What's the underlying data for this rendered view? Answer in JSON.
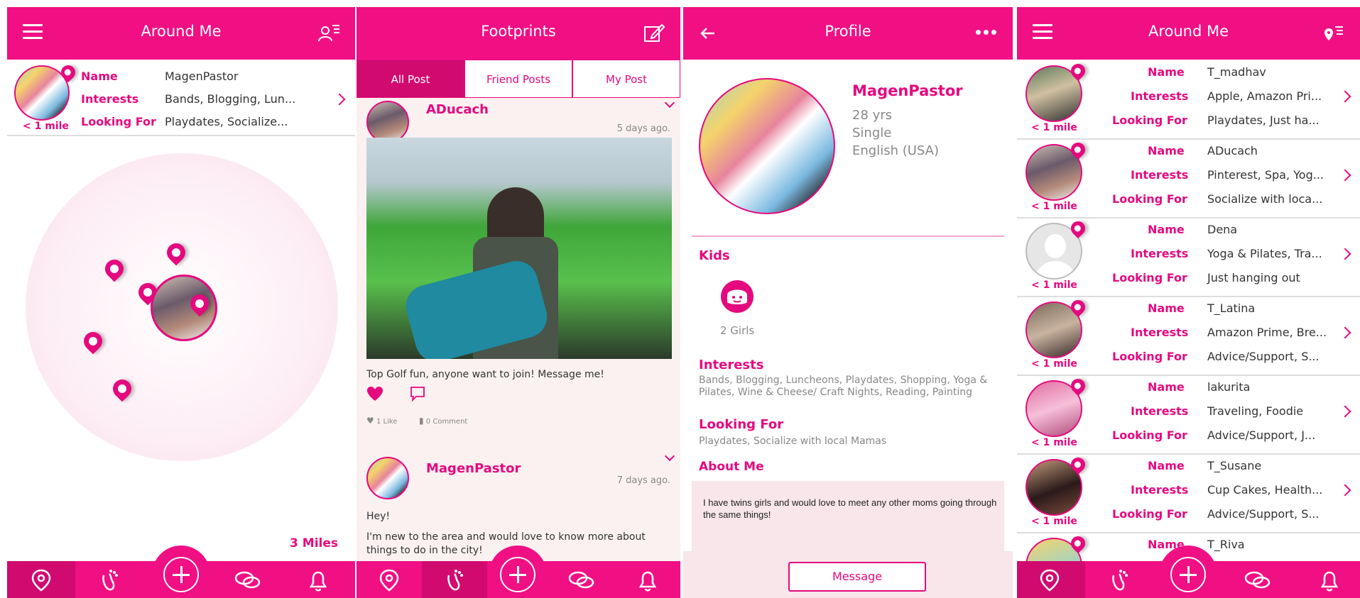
{
  "screen1": {
    "title": "Around Me",
    "header_left_icon": "menu-icon",
    "header_right_icon": "user-list-icon",
    "profile": {
      "name_label": "Name",
      "name": "MagenPastor",
      "interests_label": "Interests",
      "interests": "Bands, Blogging, Lun...",
      "looking_label": "Looking For",
      "looking": "Playdates, Socialize...",
      "distance": "< 1 mile"
    },
    "radius_label": "3 Miles"
  },
  "screen2": {
    "title": "Footprints",
    "header_right_icon": "edit-icon",
    "tabs": [
      {
        "label": "All Post",
        "active": true
      },
      {
        "label": "Friend Posts",
        "active": false
      },
      {
        "label": "My Post",
        "active": false
      }
    ],
    "posts": [
      {
        "author": "ADucach",
        "time": "5 days ago.",
        "text": "Top Golf fun, anyone want to join! Message me!",
        "likes": "1 Like",
        "comments": "0 Comment"
      },
      {
        "author": "MagenPastor",
        "time": "7 days ago.",
        "text1": "Hey!",
        "text2": "I'm new to the area and would love to know more about things to do in the city!"
      }
    ]
  },
  "screen3": {
    "title": "Profile",
    "name": "MagenPastor",
    "age": "28 yrs",
    "status": "Single",
    "language": "English (USA)",
    "kids_title": "Kids",
    "kids_value": "2 Girls",
    "interests_title": "Interests",
    "interests": "Bands, Blogging, Luncheons, Playdates, Shopping, Yoga & Pilates, Wine & Cheese/ Craft Nights, Reading, Painting",
    "looking_title": "Looking For",
    "looking": "Playdates, Socialize with local Mamas",
    "about_title": "About Me",
    "about": "I have twins girls and would love to meet any other moms going through the same things!",
    "message_button": "Message"
  },
  "screen4": {
    "title": "Around Me",
    "header_right_icon": "map-pin-list-icon",
    "labels": {
      "name": "Name",
      "interests": "Interests",
      "looking": "Looking For"
    },
    "users": [
      {
        "name": "T_madhav",
        "interests": "Apple, Amazon Pri...",
        "looking": "Playdates, Just ha...",
        "distance": "< 1 mile"
      },
      {
        "name": "ADucach",
        "interests": "Pinterest, Spa, Yog...",
        "looking": "Socialize with loca...",
        "distance": "< 1 mile"
      },
      {
        "name": "Dena",
        "interests": "Yoga & Pilates, Tra...",
        "looking": "Just hanging out",
        "distance": "< 1 mile"
      },
      {
        "name": "T_Latina",
        "interests": "Amazon Prime, Bre...",
        "looking": "Advice/Support, S...",
        "distance": "< 1 mile"
      },
      {
        "name": "lakurita",
        "interests": "Traveling, Foodie",
        "looking": "Advice/Support, J...",
        "distance": "< 1 mile"
      },
      {
        "name": "T_Susane",
        "interests": "Cup Cakes, Health...",
        "looking": "Advice/Support, S...",
        "distance": "< 1 mile"
      },
      {
        "name": "T_Riva",
        "interests": "",
        "looking": "",
        "distance": ""
      }
    ]
  },
  "nav_icons": [
    "location-icon",
    "footprint-icon",
    "plus-icon",
    "chat-icon",
    "bell-icon"
  ],
  "colors": {
    "brand": "#f10f84",
    "brand_dark": "#d10a70",
    "text_pink": "#e5097f"
  }
}
